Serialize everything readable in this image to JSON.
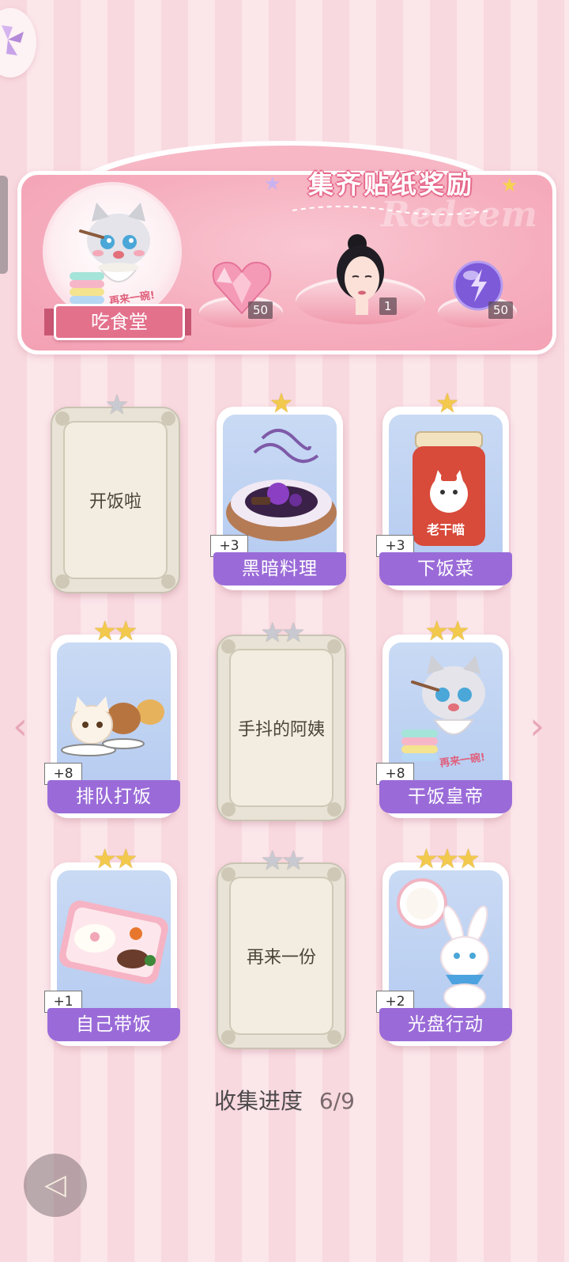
{
  "banner": {
    "title": "集齐贴纸奖励",
    "watermark": "Redeem",
    "cafeteria_label": "吃食堂",
    "cafeteria_sub": "再来一碗!",
    "rewards": [
      {
        "item": "pink-heart-gem",
        "count": "50"
      },
      {
        "item": "lady-avatar",
        "count": "1"
      },
      {
        "item": "lightning-orb",
        "count": "50"
      }
    ]
  },
  "cards": [
    {
      "name": "开饭啦",
      "stars": 1,
      "unlocked": false,
      "bonus": ""
    },
    {
      "name": "黑暗料理",
      "stars": 1,
      "unlocked": true,
      "bonus": "+3",
      "sub": ""
    },
    {
      "name": "下饭菜",
      "stars": 1,
      "unlocked": true,
      "bonus": "+3",
      "sub": "老干喵"
    },
    {
      "name": "排队打饭",
      "stars": 2,
      "unlocked": true,
      "bonus": "+8",
      "sub": ""
    },
    {
      "name": "手抖的阿姨",
      "stars": 2,
      "unlocked": false,
      "bonus": ""
    },
    {
      "name": "干饭皇帝",
      "stars": 2,
      "unlocked": true,
      "bonus": "+8",
      "sub": "再来一碗!"
    },
    {
      "name": "自己带饭",
      "stars": 2,
      "unlocked": true,
      "bonus": "+1",
      "sub": ""
    },
    {
      "name": "再来一份",
      "stars": 2,
      "unlocked": false,
      "bonus": ""
    },
    {
      "name": "光盘行动",
      "stars": 3,
      "unlocked": true,
      "bonus": "+2",
      "sub": ""
    }
  ],
  "progress": {
    "label": "收集进度",
    "value": "6/9"
  },
  "colors": {
    "name_bar": "#9a6bd8",
    "banner": "#f6aebe",
    "star_gold": "#f2c94c"
  }
}
